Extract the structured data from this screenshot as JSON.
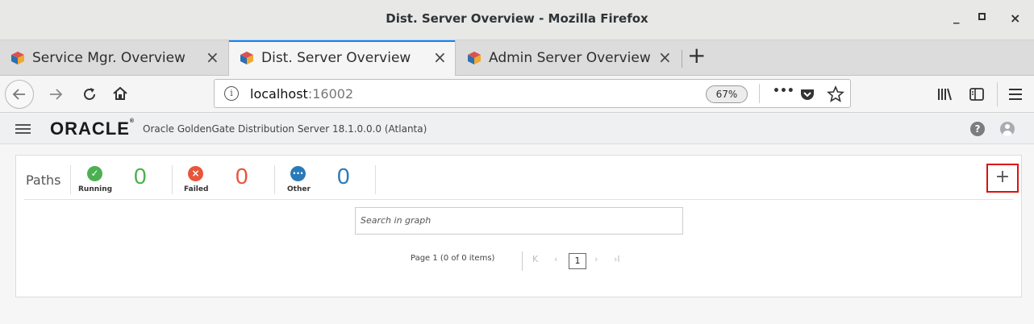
{
  "window": {
    "title": "Dist. Server Overview - Mozilla Firefox",
    "controls": {
      "minimize": "_",
      "close": "×"
    }
  },
  "tabs": [
    {
      "label": "Service Mgr. Overview",
      "active": false
    },
    {
      "label": "Dist. Server Overview",
      "active": true
    },
    {
      "label": "Admin Server Overview",
      "active": false
    }
  ],
  "tab_close": "×",
  "new_tab": "+",
  "nav": {
    "url_host": "localhost",
    "url_port": ":16002",
    "zoom": "67%",
    "page_actions": "•••"
  },
  "app": {
    "logo": "ORACLE",
    "product": "Oracle GoldenGate Distribution Server 18.1.0.0.0 (Atlanta)",
    "help": "?"
  },
  "paths": {
    "label": "Paths",
    "running": {
      "label": "Running",
      "count": "0",
      "color": "#4cb050"
    },
    "failed": {
      "label": "Failed",
      "count": "0",
      "color": "#e8553b"
    },
    "other": {
      "label": "Other",
      "count": "0",
      "color": "#2a7ab8"
    },
    "add": "+"
  },
  "search": {
    "placeholder": "Search in graph"
  },
  "pager": {
    "text": "Page  1  (0 of 0 items)",
    "first": "K",
    "prev": "‹",
    "current": "1",
    "next": "›",
    "last": "›I"
  }
}
